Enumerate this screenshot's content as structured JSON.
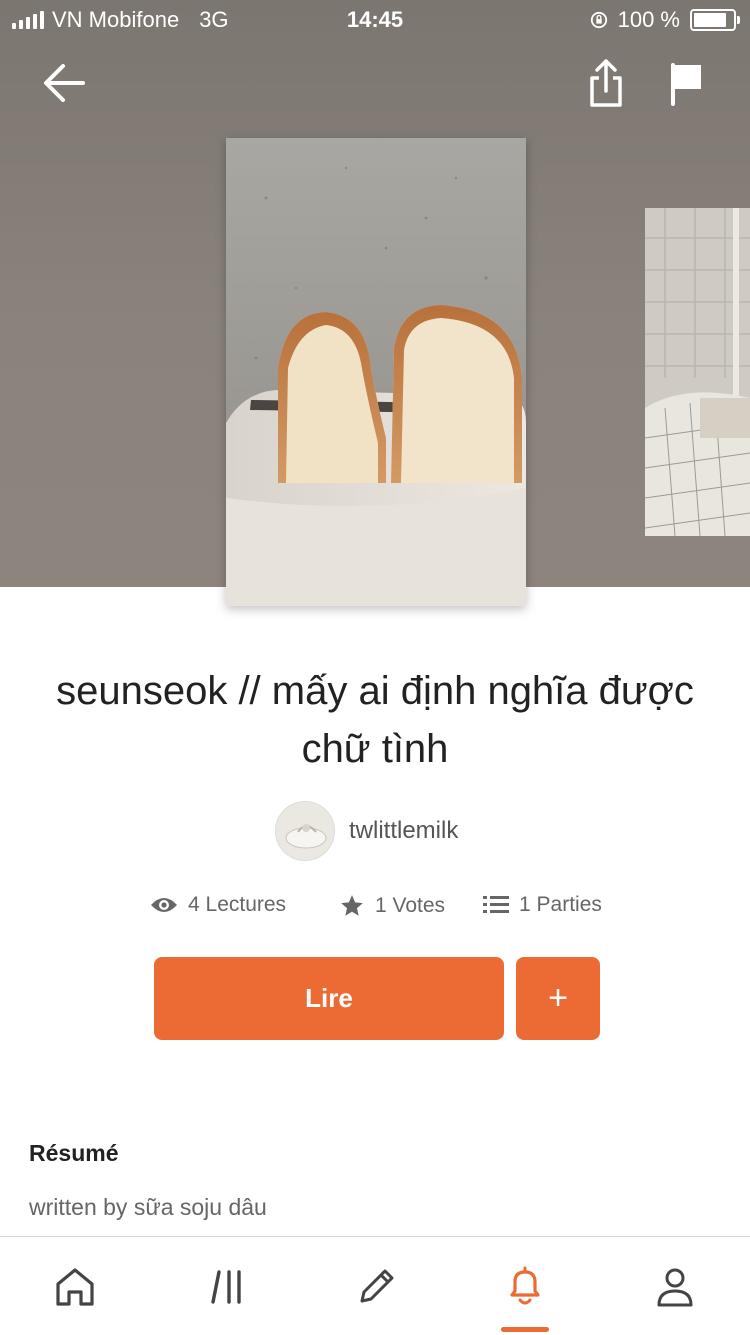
{
  "status_bar": {
    "carrier": "VN Mobifone",
    "network": "3G",
    "time": "14:45",
    "battery": "100 %"
  },
  "story": {
    "title": "seunseok // mấy ai định nghĩa được chữ tình",
    "author": "twlittlemilk",
    "stats": {
      "reads": "4 Lectures",
      "votes": "1 Votes",
      "parts": "1 Parties"
    }
  },
  "actions": {
    "read_label": "Lire",
    "add_label": "+"
  },
  "summary": {
    "heading": "Résumé",
    "text": "written by sữa soju dâu"
  },
  "icons": {
    "back": "arrow-left-icon",
    "share": "share-icon",
    "report": "flag-icon",
    "home": "home-icon",
    "library": "library-icon",
    "write": "pencil-icon",
    "notifications": "bell-icon",
    "profile": "person-icon"
  },
  "colors": {
    "accent": "#ec6b35",
    "hero_background": "#857e77"
  },
  "tabs": {
    "active": "notifications"
  }
}
